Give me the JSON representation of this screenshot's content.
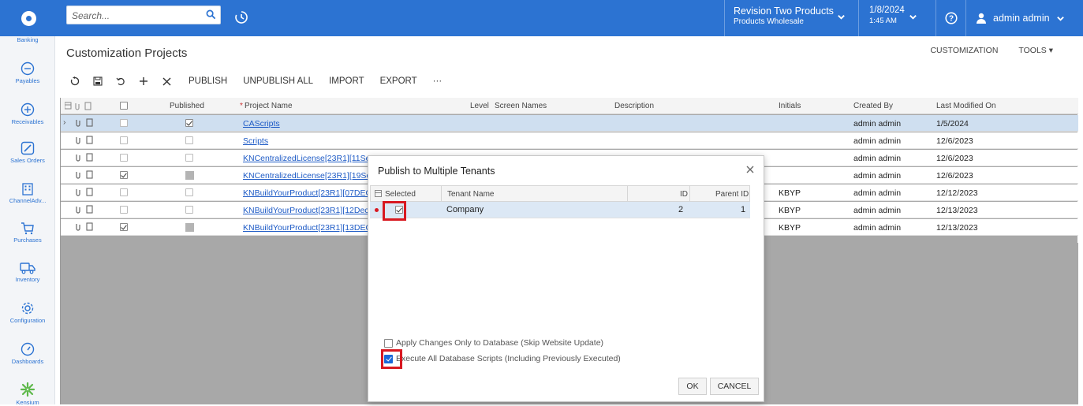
{
  "topbar": {
    "search_placeholder": "Search...",
    "branch_name": "Revision Two Products",
    "branch_sub": "Products Wholesale",
    "date": "1/8/2024",
    "time": "1:45 AM",
    "user_name": "admin admin"
  },
  "sidebar": {
    "items": [
      {
        "label": "Banking",
        "icon": "bank-icon"
      },
      {
        "label": "Payables",
        "icon": "minus-circle-icon"
      },
      {
        "label": "Receivables",
        "icon": "plus-circle-icon"
      },
      {
        "label": "Sales Orders",
        "icon": "pencil-icon"
      },
      {
        "label": "ChannelAdv...",
        "icon": "building-icon"
      },
      {
        "label": "Purchases",
        "icon": "cart-icon"
      },
      {
        "label": "Inventory",
        "icon": "truck-icon"
      },
      {
        "label": "Configuration",
        "icon": "gear-icon"
      },
      {
        "label": "Dashboards",
        "icon": "gauge-icon"
      },
      {
        "label": "Kensium",
        "icon": "kensium-logo"
      }
    ]
  },
  "page": {
    "title": "Customization Projects",
    "link_customization": "CUSTOMIZATION",
    "link_tools": "TOOLS ▾"
  },
  "toolbar": {
    "publish": "PUBLISH",
    "unpublish_all": "UNPUBLISH ALL",
    "import": "IMPORT",
    "export": "EXPORT",
    "more": "···"
  },
  "grid": {
    "columns": {
      "published": "Published",
      "project_name": "Project Name",
      "level": "Level",
      "screen_names": "Screen Names",
      "description": "Description",
      "initials": "Initials",
      "created_by": "Created By",
      "last_modified": "Last Modified On"
    },
    "rows": [
      {
        "selected": false,
        "published": true,
        "project": "CAScripts",
        "initials": "",
        "created_by": "admin admin",
        "modified": "1/5/2024"
      },
      {
        "selected": false,
        "published": false,
        "project": "Scripts",
        "initials": "",
        "created_by": "admin admin",
        "modified": "12/6/2023"
      },
      {
        "selected": false,
        "published": false,
        "project": "KNCentralizedLicense[23R1][11Se",
        "initials": "",
        "created_by": "admin admin",
        "modified": "12/6/2023"
      },
      {
        "selected": true,
        "published": null,
        "project": "KNCentralizedLicense[23R1][19Se",
        "initials": "",
        "created_by": "admin admin",
        "modified": "12/6/2023"
      },
      {
        "selected": false,
        "published": false,
        "project": "KNBuildYourProduct[23R1][07DEC",
        "initials": "KBYP",
        "created_by": "admin admin",
        "modified": "12/12/2023"
      },
      {
        "selected": false,
        "published": false,
        "project": "KNBuildYourProduct[23R1][12Dec",
        "initials": "KBYP",
        "created_by": "admin admin",
        "modified": "12/13/2023"
      },
      {
        "selected": true,
        "published": null,
        "project": "KNBuildYourProduct[23R1][13DEC",
        "initials": "KBYP",
        "created_by": "admin admin",
        "modified": "12/13/2023"
      }
    ]
  },
  "dialog": {
    "title": "Publish to Multiple Tenants",
    "col_selected": "Selected",
    "col_tenant": "Tenant Name",
    "col_id": "ID",
    "col_parent": "Parent ID",
    "tenant_name": "Company",
    "tenant_id": "2",
    "tenant_parent": "1",
    "opt_db_only": "Apply Changes Only to Database (Skip Website Update)",
    "opt_execute": "Execute All Database Scripts (Including Previously Executed)",
    "ok": "OK",
    "cancel": "CANCEL"
  },
  "colors": {
    "brand_blue": "#2c73d2",
    "highlight_red": "#d81921",
    "selected_row": "#cfdff0"
  }
}
